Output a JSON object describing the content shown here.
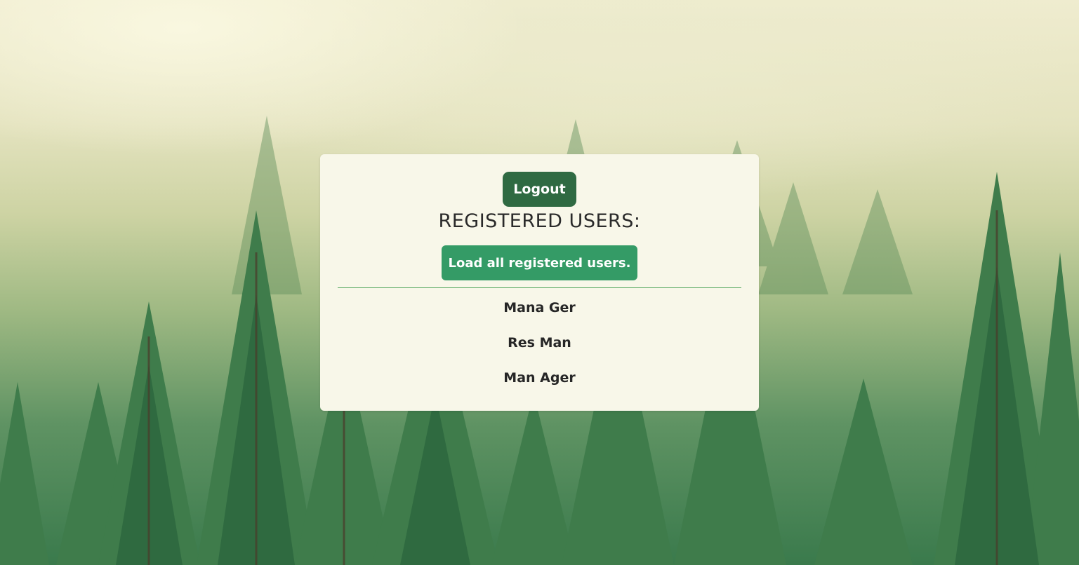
{
  "page": {
    "logout_label": "Logout",
    "heading": "REGISTERED USERS:",
    "load_label": "Load all registered users.",
    "users": [
      "Mana Ger",
      "Res Man",
      "Man Ager"
    ]
  },
  "colors": {
    "panel_background": "#f8f7e9",
    "logout_button": "#2f6a42",
    "load_button": "#349b66",
    "divider": "#5aaa63"
  }
}
